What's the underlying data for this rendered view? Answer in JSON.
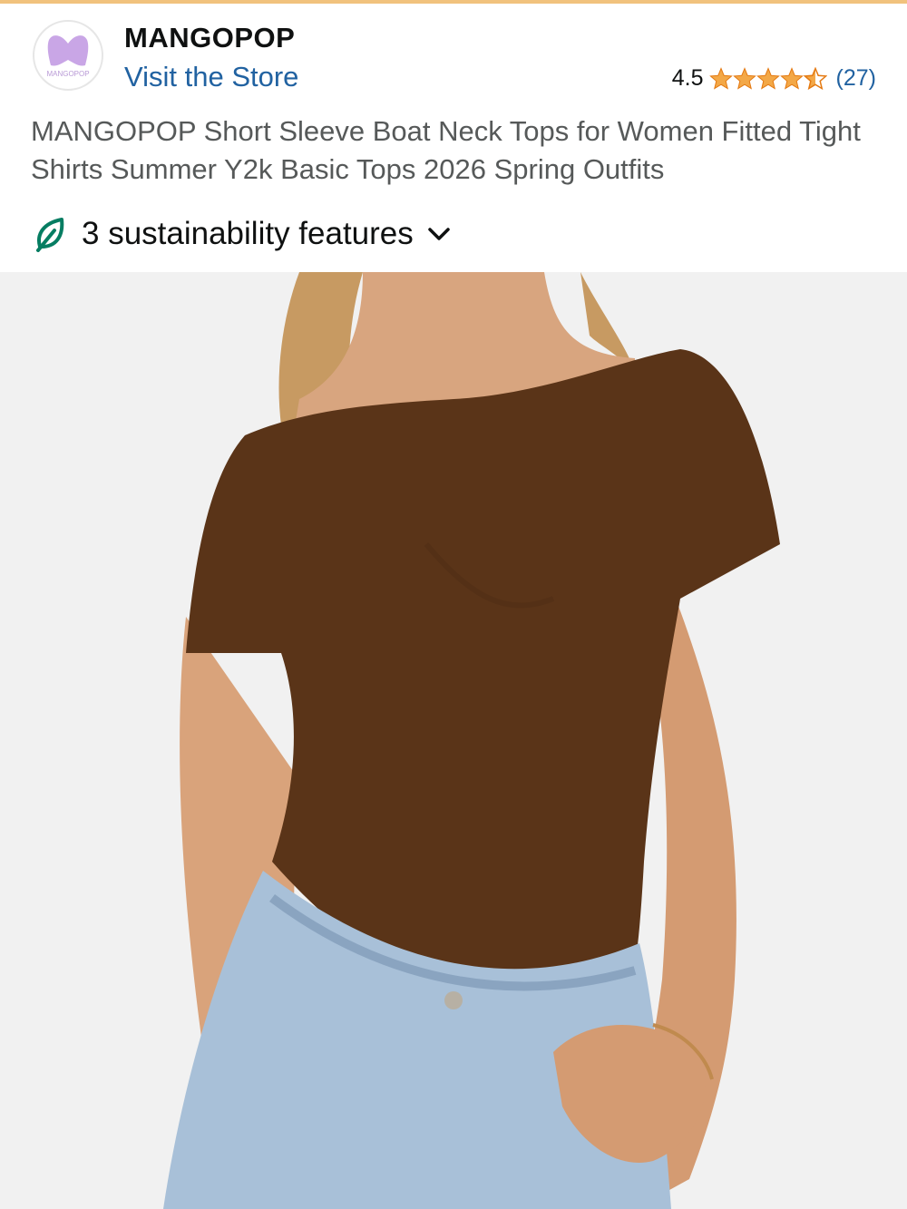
{
  "header": {
    "brand_name": "MANGOPOP",
    "logo_text": "MANGOPOP",
    "store_link": "Visit the Store",
    "rating_value": "4.5",
    "rating_stars": 4.5,
    "rating_count": "(27)",
    "star_color": "#f3a847",
    "link_color": "#2162a1"
  },
  "product": {
    "title": "MANGOPOP Short Sleeve Boat Neck Tops for Women Fitted Tight Shirts Summer Y2k Basic Tops 2026 Spring Outfits"
  },
  "sustainability": {
    "label": "3 sustainability features",
    "leaf_icon": "leaf-icon",
    "chevron_icon": "chevron-down-icon",
    "icon_color": "#067d62"
  },
  "image": {
    "subject": "product-photo",
    "garment_color": "#5a3418"
  }
}
